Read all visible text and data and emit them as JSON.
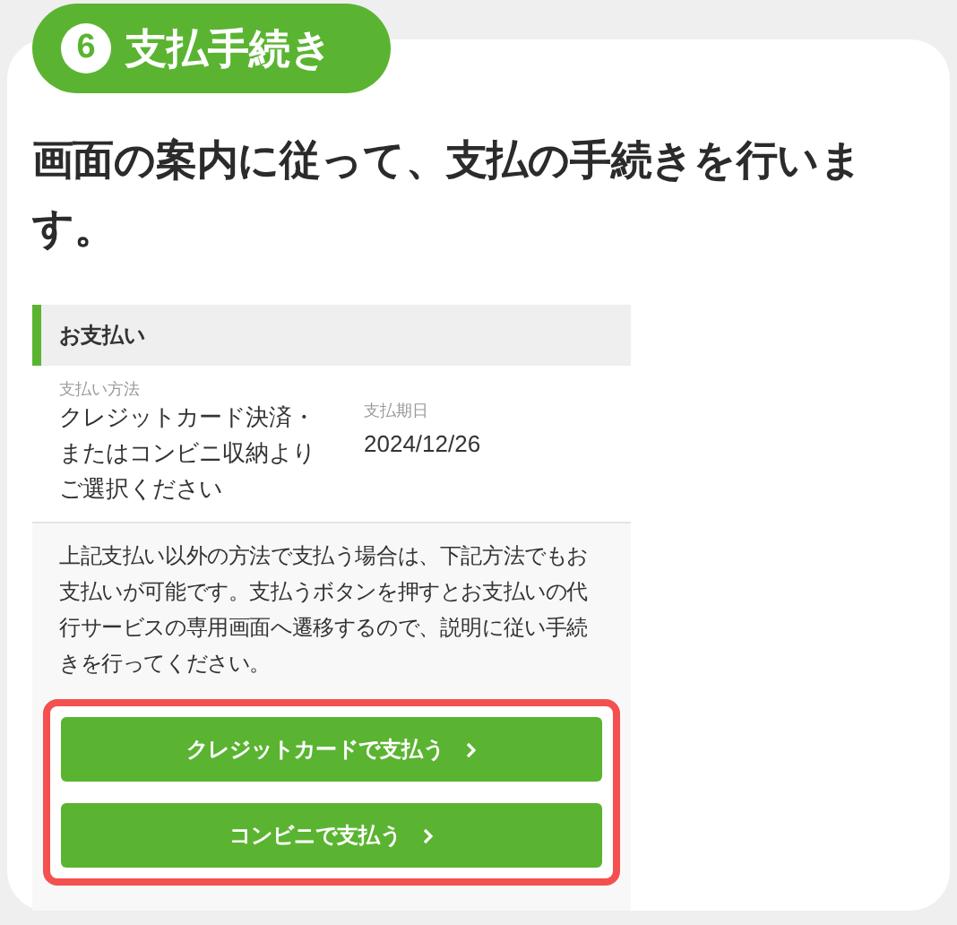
{
  "step": {
    "number": "6",
    "title": "支払手続き"
  },
  "heading": "画面の案内に従って、支払の手続きを行います。",
  "panel": {
    "title": "お支払い",
    "method": {
      "label": "支払い方法",
      "value": [
        "クレジットカード決済・",
        "またはコンビニ収納より",
        "ご選択ください"
      ]
    },
    "due": {
      "label": "支払期日",
      "value": "2024/12/26"
    },
    "note": "上記支払い以外の方法で支払う場合は、下記方法でもお支払いが可能です。支払うボタンを押すとお支払いの代行サービスの専用画面へ遷移するので、説明に従い手続きを行ってください。",
    "buttons": [
      "クレジットカードで支払う",
      "コンビニで支払う"
    ]
  }
}
